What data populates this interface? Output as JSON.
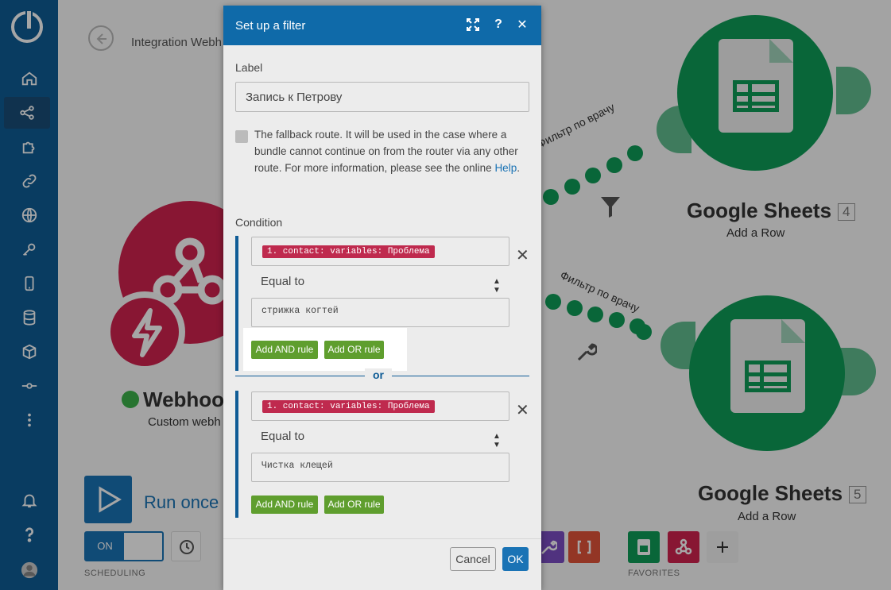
{
  "sidebar": {
    "items": [
      {
        "name": "home-icon"
      },
      {
        "name": "share-icon",
        "active": true
      },
      {
        "name": "puzzle-icon"
      },
      {
        "name": "link-icon"
      },
      {
        "name": "globe-icon"
      },
      {
        "name": "key-icon"
      },
      {
        "name": "mobile-icon"
      },
      {
        "name": "database-icon"
      },
      {
        "name": "cube-icon"
      },
      {
        "name": "flow-icon"
      },
      {
        "name": "more-vertical-icon"
      }
    ],
    "bottom": [
      {
        "name": "bell-icon"
      },
      {
        "name": "help-icon"
      },
      {
        "name": "user-avatar-icon"
      }
    ]
  },
  "canvas": {
    "breadcrumb": "Integration Webh",
    "webhook_module": {
      "title": "Webhoo",
      "subtitle": "Custom webh"
    },
    "gs_top": {
      "title": "Google Sheets",
      "number": "4",
      "subtitle": "Add a Row"
    },
    "gs_bottom": {
      "title": "Google Sheets",
      "number": "5",
      "subtitle": "Add a Row"
    },
    "route_top_label": "Фильтр по врачу",
    "route_bottom_label": "Фильтр по врачу",
    "run_once": "Run once",
    "toggle_label": "ON",
    "scheduling_caption": "SCHEDULING",
    "favorites_caption": "FAVORITES",
    "colors": {
      "sheets": "#0f9d58",
      "webhook": "#d1234f",
      "brand": "#0f5c96"
    }
  },
  "modal": {
    "title": "Set up a filter",
    "label_caption": "Label",
    "label_value": "Запись к Петрову",
    "fallback_text": "The fallback route. It will be used in the case where a bundle cannot continue on from the router via any other route. For more information, please see the online",
    "fallback_link": "Help",
    "fallback_end": ".",
    "condition_caption": "Condition",
    "groups": [
      {
        "field": "1. contact: variables: Проблема",
        "operator": "Equal to",
        "value": "стрижка когтей",
        "and_label": "Add AND rule",
        "or_label": "Add OR rule"
      },
      {
        "field": "1. contact: variables: Проблема",
        "operator": "Equal to",
        "value": "Чистка клещей",
        "and_label": "Add AND rule",
        "or_label": "Add OR rule"
      }
    ],
    "or_separator": "or",
    "cancel_label": "Cancel",
    "ok_label": "OK"
  }
}
